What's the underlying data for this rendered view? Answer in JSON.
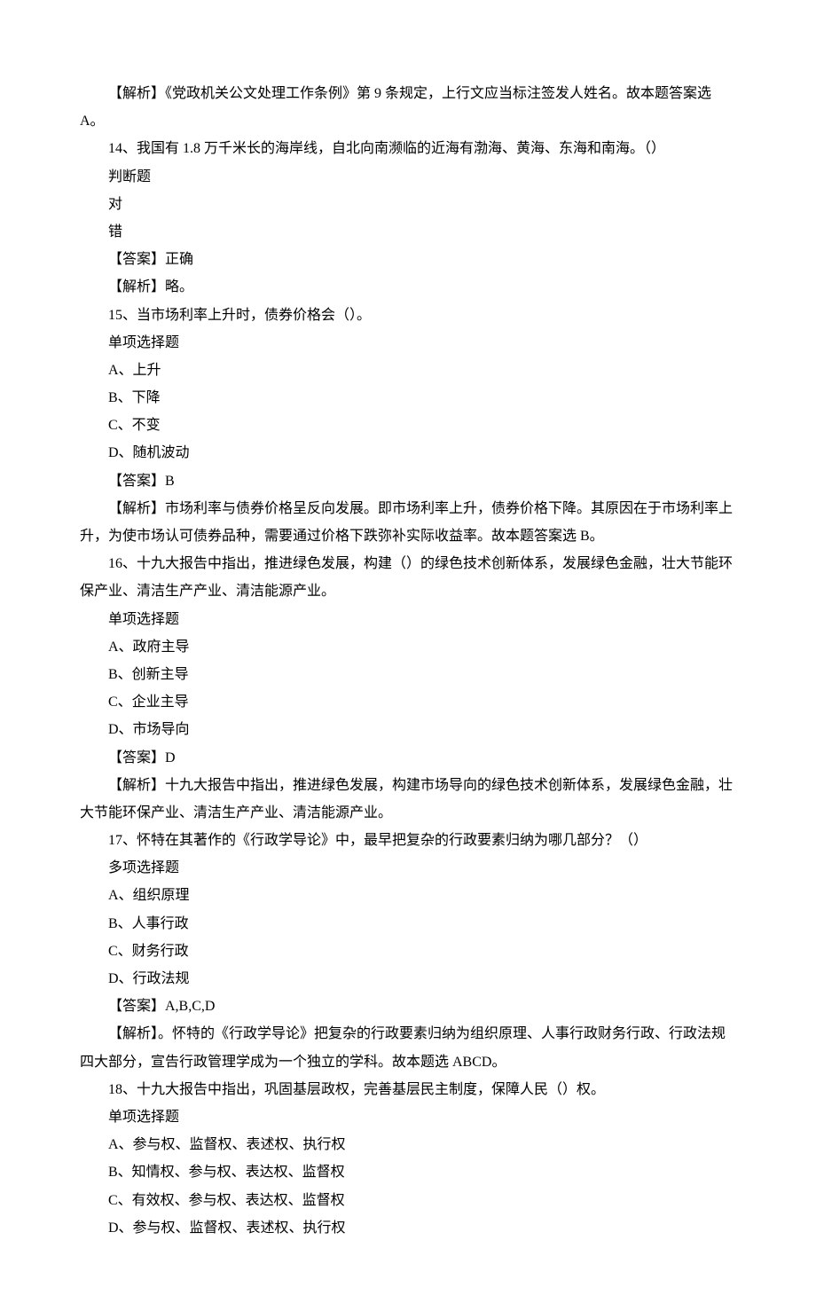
{
  "q13_explain_part1": "【解析】《党政机关公文处理工作条例》第 9 条规定，上行文应当标注签发人姓名。故本题答案选 A。",
  "q14": {
    "stem": "14、我国有 1.8 万千米长的海岸线，自北向南濒临的近海有渤海、黄海、东海和南海。（）",
    "type": "判断题",
    "opt_true": "对",
    "opt_false": "错",
    "answer": "【答案】正确",
    "explain": "【解析】略。"
  },
  "q15": {
    "stem": "15、当市场利率上升时，债券价格会（）。",
    "type": "单项选择题",
    "optA": "A、上升",
    "optB": "B、下降",
    "optC": "C、不变",
    "optD": "D、随机波动",
    "answer": "【答案】B",
    "explain": "【解析】市场利率与债券价格呈反向发展。即市场利率上升，债券价格下降。其原因在于市场利率上升，为使市场认可债券品种，需要通过价格下跌弥补实际收益率。故本题答案选 B。"
  },
  "q16": {
    "stem": "16、十九大报告中指出，推进绿色发展，构建（）的绿色技术创新体系，发展绿色金融，壮大节能环保产业、清洁生产产业、清洁能源产业。",
    "type": "单项选择题",
    "optA": "A、政府主导",
    "optB": "B、创新主导",
    "optC": "C、企业主导",
    "optD": "D、市场导向",
    "answer": "【答案】D",
    "explain": "【解析】十九大报告中指出，推进绿色发展，构建市场导向的绿色技术创新体系，发展绿色金融，壮大节能环保产业、清洁生产产业、清洁能源产业。"
  },
  "q17": {
    "stem": "17、怀特在其著作的《行政学导论》中，最早把复杂的行政要素归纳为哪几部分？（）",
    "type": "多项选择题",
    "optA": "A、组织原理",
    "optB": "B、人事行政",
    "optC": "C、财务行政",
    "optD": "D、行政法规",
    "answer": "【答案】A,B,C,D",
    "explain": "【解析】。怀特的《行政学导论》把复杂的行政要素归纳为组织原理、人事行政财务行政、行政法规四大部分，宣告行政管理学成为一个独立的学科。故本题选 ABCD。"
  },
  "q18": {
    "stem": "18、十九大报告中指出，巩固基层政权，完善基层民主制度，保障人民（）权。",
    "type": "单项选择题",
    "optA": "A、参与权、监督权、表述权、执行权",
    "optB": "B、知情权、参与权、表达权、监督权",
    "optC": "C、有效权、参与权、表达权、监督权",
    "optD": "D、参与权、监督权、表述权、执行权"
  }
}
